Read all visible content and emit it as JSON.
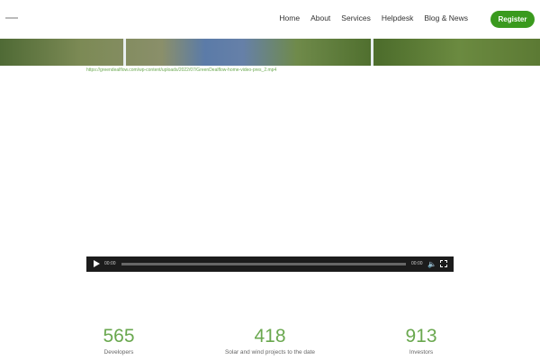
{
  "nav": {
    "items": [
      "Home",
      "About",
      "Services",
      "Helpdesk",
      "Blog & News"
    ],
    "register": "Register"
  },
  "video": {
    "link": "https://greendealflow.com/wp-content/uploads/2022/07/GreenDealflow-home-video-pres_2.mp4",
    "current_time": "00:00",
    "duration": "00:00"
  },
  "stats": [
    {
      "value": "565",
      "label": "Developers"
    },
    {
      "value": "418",
      "label": "Solar and wind projects to the date"
    },
    {
      "value": "913",
      "label": "Investors"
    }
  ],
  "colors": {
    "accent": "#3a9a1e",
    "stat": "#6aa84f"
  }
}
